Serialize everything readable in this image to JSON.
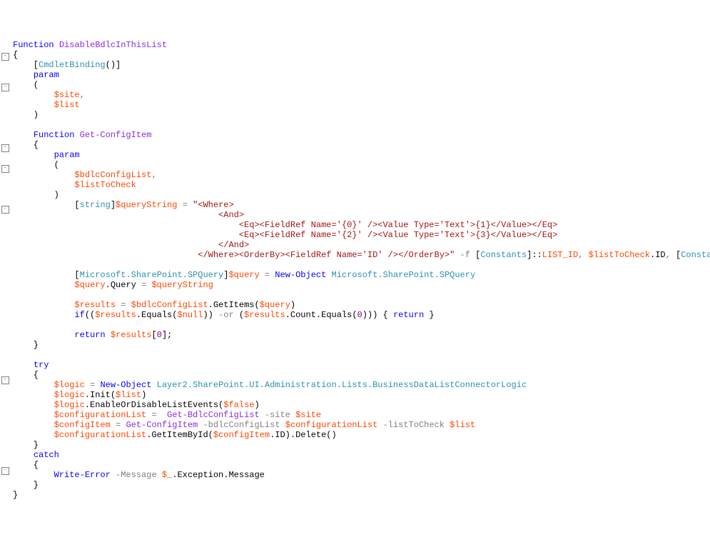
{
  "code": {
    "lines": [
      {
        "gutter": "",
        "html": "<span class='kw'>Function</span> <span class='func'>DisableBdlcInThisList</span>"
      },
      {
        "gutter": "-",
        "html": "{"
      },
      {
        "gutter": "",
        "html": "    [<span class='type'>CmdletBinding</span>()]"
      },
      {
        "gutter": "",
        "html": "    <span class='kw'>param</span>"
      },
      {
        "gutter": "-",
        "html": "    ("
      },
      {
        "gutter": "",
        "html": "        <span class='var'>$site</span><span class='punct'>,</span>"
      },
      {
        "gutter": "",
        "html": "        <span class='var'>$list</span>"
      },
      {
        "gutter": "",
        "html": "    )"
      },
      {
        "gutter": "",
        "html": ""
      },
      {
        "gutter": "",
        "html": "    <span class='kw'>Function</span> <span class='func'>Get-ConfigItem</span>"
      },
      {
        "gutter": "-",
        "html": "    {"
      },
      {
        "gutter": "",
        "html": "        <span class='kw'>param</span>"
      },
      {
        "gutter": "-",
        "html": "        ("
      },
      {
        "gutter": "",
        "html": "            <span class='var'>$bdlcConfigList</span><span class='punct'>,</span>"
      },
      {
        "gutter": "",
        "html": "            <span class='var'>$listToCheck</span>"
      },
      {
        "gutter": "",
        "html": "        )"
      },
      {
        "gutter": "-",
        "html": "            [<span class='type'>string</span>]<span class='var'>$queryString</span> <span class='op'>=</span> <span class='str'>\"&lt;Where&gt;</span>"
      },
      {
        "gutter": "",
        "html": "<span class='str'>                                        &lt;And&gt;</span>"
      },
      {
        "gutter": "",
        "html": "<span class='str'>                                            &lt;Eq&gt;&lt;FieldRef Name='{0}' /&gt;&lt;Value Type='Text'&gt;{1}&lt;/Value&gt;&lt;/Eq&gt;</span>"
      },
      {
        "gutter": "",
        "html": "<span class='str'>                                            &lt;Eq&gt;&lt;FieldRef Name='{2}' /&gt;&lt;Value Type='Text'&gt;{3}&lt;/Value&gt;&lt;/Eq&gt;</span>"
      },
      {
        "gutter": "",
        "html": "<span class='str'>                                        &lt;/And&gt;</span>"
      },
      {
        "gutter": "",
        "html": "<span class='str'>                                    &lt;/Where&gt;&lt;OrderBy&gt;&lt;FieldRef Name='ID' /&gt;&lt;/OrderBy&gt;\"</span> <span class='op'>-f</span> [<span class='type'>Constants</span>]::<span class='var'>LIST_ID</span><span class='punct'>,</span> <span class='var'>$listToCheck</span>.ID<span class='punct'>,</span> [<span class='type'>Consta</span>"
      },
      {
        "gutter": "",
        "html": ""
      },
      {
        "gutter": "",
        "html": "            [<span class='type'>Microsoft.SharePoint.SPQuery</span>]<span class='var'>$query</span> <span class='op'>=</span> <span class='kw'>New-Object</span> <span class='type'>Microsoft.SharePoint.SPQuery</span>"
      },
      {
        "gutter": "",
        "html": "            <span class='var'>$query</span>.Query <span class='op'>=</span> <span class='var'>$queryString</span>"
      },
      {
        "gutter": "",
        "html": ""
      },
      {
        "gutter": "",
        "html": "            <span class='var'>$results</span> <span class='op'>=</span> <span class='var'>$bdlcConfigList</span>.GetItems(<span class='var'>$query</span>)"
      },
      {
        "gutter": "",
        "html": "            <span class='kw'>if</span>((<span class='var'>$results</span>.Equals(<span class='var'>$null</span>)) <span class='op'>-or</span> (<span class='var'>$results</span>.Count.Equals(<span class='num'>0</span>))) { <span class='kw'>return</span> }"
      },
      {
        "gutter": "",
        "html": ""
      },
      {
        "gutter": "",
        "html": "            <span class='kw'>return</span> <span class='var'>$results</span>[<span class='num'>0</span>];"
      },
      {
        "gutter": "",
        "html": "    }"
      },
      {
        "gutter": "",
        "html": ""
      },
      {
        "gutter": "",
        "html": "    <span class='kw'>try</span>"
      },
      {
        "gutter": "-",
        "html": "    {"
      },
      {
        "gutter": "",
        "html": "        <span class='var'>$logic</span> <span class='op'>=</span> <span class='kw'>New-Object</span> <span class='type'>Layer2.SharePoint.UI.Administration.Lists.BusinessDataListConnectorLogic</span>"
      },
      {
        "gutter": "",
        "html": "        <span class='var'>$logic</span>.Init(<span class='var'>$list</span>)"
      },
      {
        "gutter": "",
        "html": "        <span class='var'>$logic</span>.EnableOrDisableListEvents(<span class='var'>$false</span>)"
      },
      {
        "gutter": "",
        "html": "        <span class='var'>$configurationList</span> <span class='op'>=</span>  <span class='func'>Get-BdlcConfigList</span> <span class='op'>-site</span> <span class='var'>$site</span>"
      },
      {
        "gutter": "",
        "html": "        <span class='var'>$configItem</span> <span class='op'>=</span> <span class='func'>Get-ConfigItem</span> <span class='op'>-bdlcConfigList</span> <span class='var'>$configurationList</span> <span class='op'>-listToCheck</span> <span class='var'>$list</span>"
      },
      {
        "gutter": "",
        "html": "        <span class='var'>$configurationList</span>.GetItemById(<span class='var'>$configItem</span>.ID).Delete()"
      },
      {
        "gutter": "",
        "html": "    }"
      },
      {
        "gutter": "",
        "html": "    <span class='kw'>catch</span>"
      },
      {
        "gutter": "-",
        "html": "    {"
      },
      {
        "gutter": "",
        "html": "        <span class='kw'>Write-Error</span> <span class='op'>-Message</span> <span class='var'>$_</span>.Exception.Message"
      },
      {
        "gutter": "",
        "html": "    }"
      },
      {
        "gutter": "",
        "html": "}"
      }
    ]
  }
}
